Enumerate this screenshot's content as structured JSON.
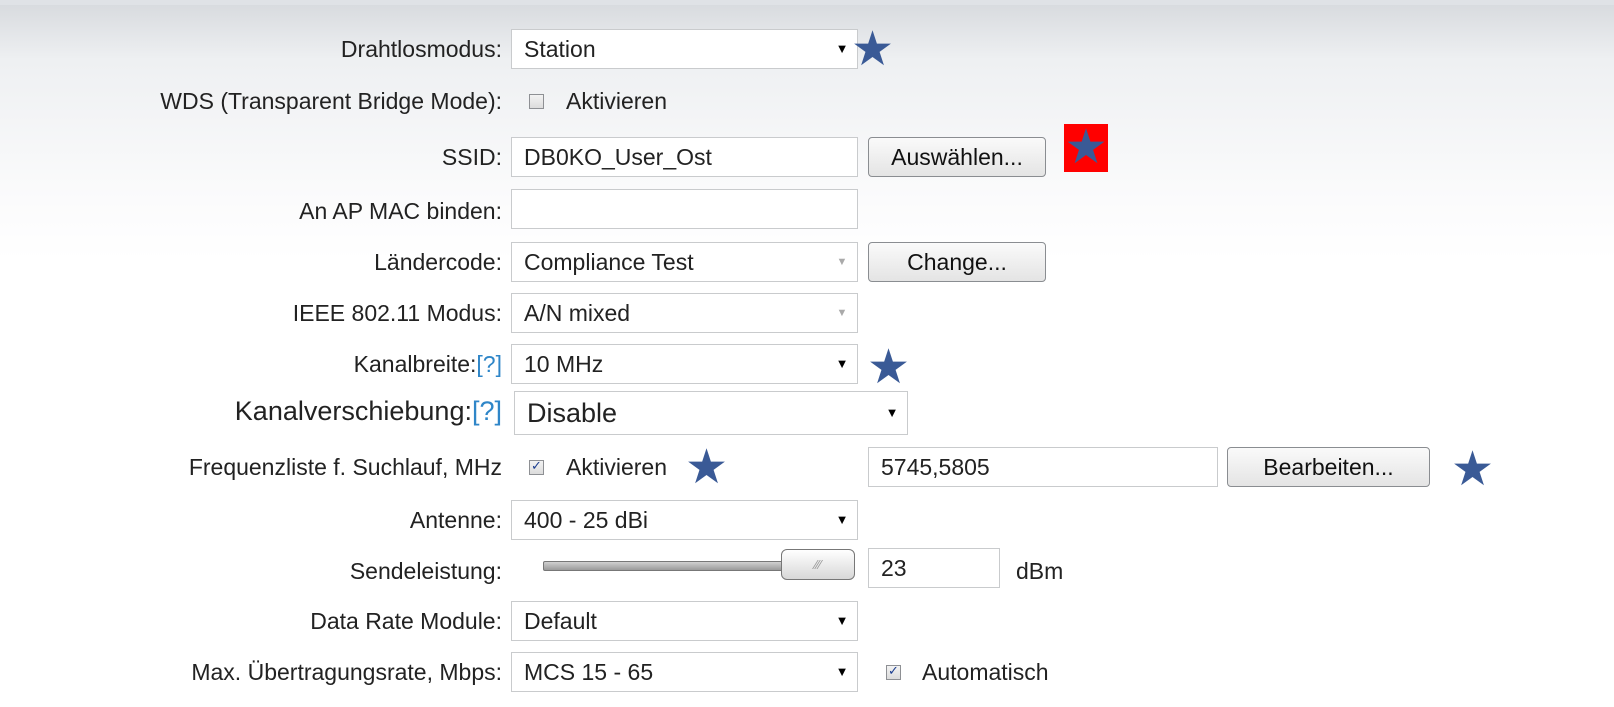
{
  "wireless_mode": {
    "label": "Drahtlosmodus:",
    "value": "Station"
  },
  "wds": {
    "label": "WDS (Transparent Bridge Mode):",
    "checkbox_label": "Aktivieren",
    "checked": false
  },
  "ssid": {
    "label": "SSID:",
    "value": "DB0KO_User_Ost",
    "button": "Auswählen..."
  },
  "ap_mac": {
    "label": "An AP MAC binden:",
    "value": ""
  },
  "country": {
    "label": "Ländercode:",
    "value": "Compliance Test",
    "button": "Change..."
  },
  "ieee_mode": {
    "label": "IEEE 802.11 Modus:",
    "value": "A/N mixed"
  },
  "channel_width": {
    "label": "Kanalbreite:",
    "help": "[?]",
    "value": "10 MHz"
  },
  "channel_shift": {
    "label": "Kanalverschiebung:",
    "help": "[?]",
    "value": "Disable"
  },
  "freq_list": {
    "label": "Frequenzliste f. Suchlauf, MHz",
    "checkbox_label": "Aktivieren",
    "checked": true,
    "value": "5745,5805",
    "button": "Bearbeiten..."
  },
  "antenna": {
    "label": "Antenne:",
    "value": "400 - 25 dBi"
  },
  "tx_power": {
    "label": "Sendeleistung:",
    "value": "23",
    "unit": "dBm",
    "slider_fraction": 1.0
  },
  "data_rate": {
    "label": "Data Rate Module:",
    "value": "Default"
  },
  "max_rate": {
    "label": "Max. Übertragungsrate, Mbps:",
    "value": "MCS 15 - 65",
    "checkbox_label": "Automatisch",
    "checked": true
  },
  "glyphs": {
    "star": "★",
    "dropdown": "▼",
    "check": "✓",
    "grip": "⁄⁄⁄"
  },
  "colors": {
    "star": "#3a5a96",
    "highlight": "#ff0000",
    "help_link": "#2f86c8"
  }
}
